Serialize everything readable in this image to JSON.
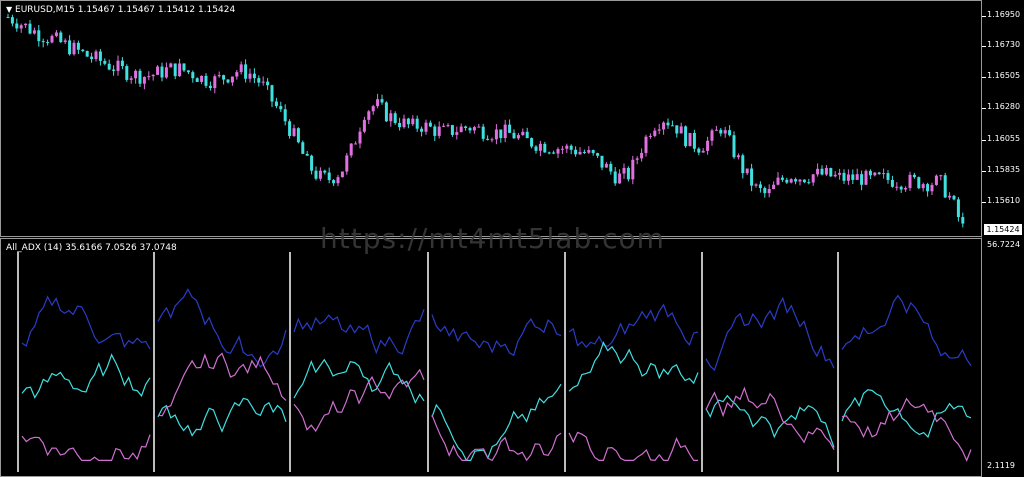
{
  "main_chart": {
    "symbol_title": "EURUSD,M15  1.15467 1.15467 1.15412 1.15424",
    "current_price": "1.15424",
    "price_ticks": [
      "1.16950",
      "1.16730",
      "1.16505",
      "1.16280",
      "1.16055",
      "1.15835",
      "1.15610"
    ],
    "bull_color": "#e070e0",
    "bear_color": "#40e0e0"
  },
  "indicator": {
    "title": "All_ADX (14) 35.6166 7.0526 37.0748",
    "max_label": "56.7224",
    "min_label": "2.1119",
    "panel_count": 7,
    "adx_color": "#2a3cc8",
    "plus_di_color": "#40e0e0",
    "minus_di_color": "#d070d0"
  },
  "watermark": "https://mt4mt5lab.com",
  "chart_data": [
    {
      "type": "candlestick",
      "title": "EURUSD,M15",
      "ylim": [
        1.1542,
        1.1697
      ],
      "close_path": [
        1.1692,
        1.1688,
        1.1683,
        1.1679,
        1.1676,
        1.1672,
        1.1668,
        1.1664,
        1.1661,
        1.1657,
        1.1654,
        1.1651,
        1.165,
        1.1652,
        1.1655,
        1.1655,
        1.1652,
        1.1648,
        1.1647,
        1.165,
        1.1654,
        1.1652,
        1.1645,
        1.1632,
        1.162,
        1.1605,
        1.1588,
        1.1578,
        1.1577,
        1.1583,
        1.16,
        1.1625,
        1.163,
        1.1622,
        1.1618,
        1.1614,
        1.1615,
        1.1612,
        1.161,
        1.1612,
        1.1614,
        1.1612,
        1.161,
        1.161,
        1.1608,
        1.1604,
        1.1602,
        1.16,
        1.1599,
        1.1598,
        1.1596,
        1.1592,
        1.1585,
        1.1578,
        1.158,
        1.1598,
        1.1615,
        1.162,
        1.1615,
        1.1605,
        1.16,
        1.1604,
        1.1614,
        1.1598,
        1.1582,
        1.157,
        1.1565,
        1.1575,
        1.158,
        1.1578,
        1.158,
        1.158,
        1.1578,
        1.1577,
        1.1578,
        1.1576,
        1.1577,
        1.1576,
        1.1575,
        1.1575,
        1.1574,
        1.1575,
        1.1562,
        1.1542
      ]
    },
    {
      "type": "line",
      "title": "All_ADX (14)",
      "ylim": [
        2.1119,
        56.7224
      ],
      "panels": 7
    }
  ]
}
